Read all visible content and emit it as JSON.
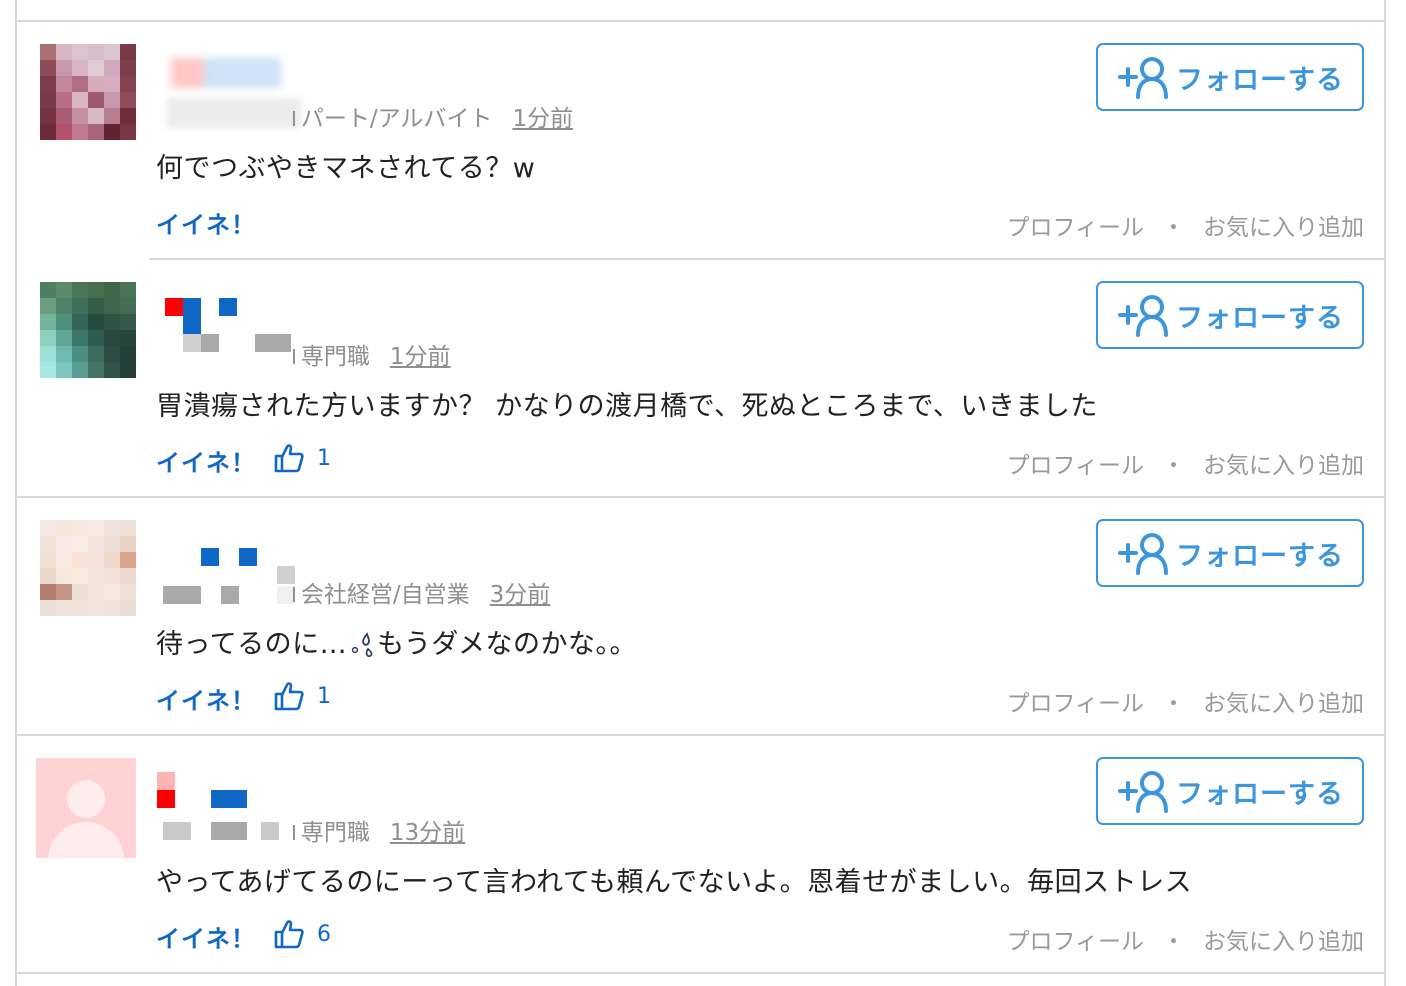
{
  "posts": [
    {
      "occupation": "パート/アルバイト",
      "time": "1分前",
      "comment": "何でつぶやきマネされてる？w",
      "iine_label": "イイネ！",
      "like_count": null,
      "follow_label": "フォローする",
      "profile_label": "プロフィール",
      "separator": "・",
      "favorite_label": "お気に入り追加"
    },
    {
      "occupation": "専門職",
      "time": "1分前",
      "comment": "胃潰瘍された方いますか？ かなりの渡月橋で、死ぬところまで、いきました",
      "iine_label": "イイネ！",
      "like_count": "1",
      "follow_label": "フォローする",
      "profile_label": "プロフィール",
      "separator": "・",
      "favorite_label": "お気に入り追加"
    },
    {
      "occupation": "会社経営/自営業",
      "time": "3分前",
      "comment_before": "待ってるのに…",
      "comment_after": "もうダメなのかな。。",
      "iine_label": "イイネ！",
      "like_count": "1",
      "follow_label": "フォローする",
      "profile_label": "プロフィール",
      "separator": "・",
      "favorite_label": "お気に入り追加"
    },
    {
      "occupation": "専門職",
      "time": "13分前",
      "comment": "やってあげてるのにーって言われても頼んでないよ。恩着せがましい。毎回ストレス",
      "iine_label": "イイネ！",
      "like_count": "6",
      "follow_label": "フォローする",
      "profile_label": "プロフィール",
      "separator": "・",
      "favorite_label": "お気に入り追加"
    }
  ],
  "icons": {
    "follow": "add-user-icon",
    "like": "thumbs-up-icon",
    "emoji": "sweat-drop-icon"
  },
  "colors": {
    "accent": "#3b96de",
    "link": "#1068c6",
    "muted": "#9a9a9a",
    "divider": "#d9d9d9"
  }
}
